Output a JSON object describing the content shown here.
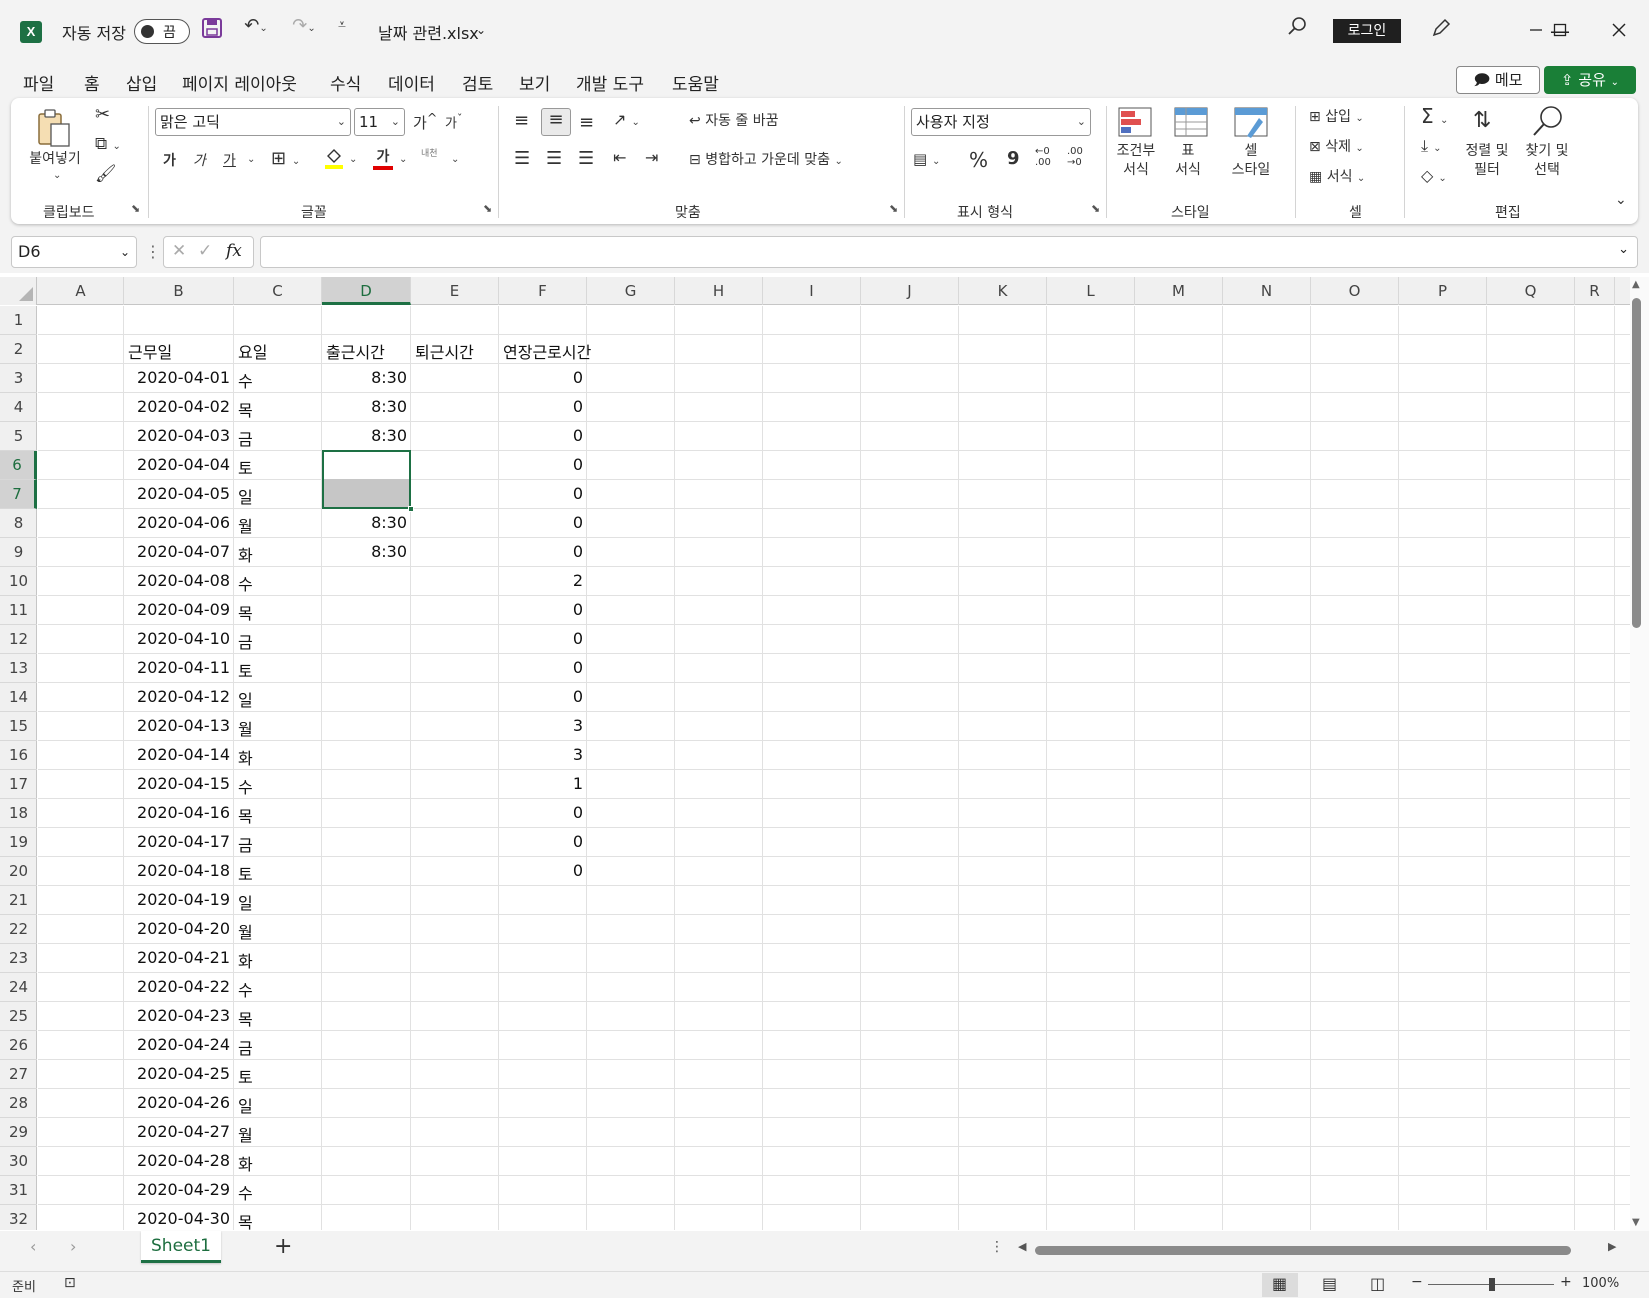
{
  "titlebar": {
    "app_icon": "excel-icon",
    "autosave_label": "자동 저장",
    "autosave_state": "끔",
    "filename": "날짜 관련.xlsx",
    "login_label": "로그인"
  },
  "menu": {
    "tabs": [
      "파일",
      "홈",
      "삽입",
      "페이지 레이아웃",
      "수식",
      "데이터",
      "검토",
      "보기",
      "개발 도구",
      "도움말"
    ],
    "active_tab": "홈",
    "memo_label": "메모",
    "share_label": "공유"
  },
  "ribbon": {
    "clipboard": {
      "paste_label": "붙여넣기",
      "group_label": "클립보드"
    },
    "font": {
      "font_name": "맑은 고딕",
      "font_size": "11",
      "bold": "가",
      "italic": "가",
      "underline": "가",
      "font_color_glyph": "가",
      "phonetic": "내천",
      "grow_font": "가",
      "shrink_font": "가",
      "group_label": "글꼴"
    },
    "alignment": {
      "wrap_text": "자동 줄 바꿈",
      "merge_center": "병합하고 가운데 맞춤",
      "group_label": "맞춤"
    },
    "number": {
      "format": "사용자 지정",
      "percent": "%",
      "comma": "9",
      "inc_decimal": "←0\n.00",
      "dec_decimal": ".00\n→0",
      "group_label": "표시 형식"
    },
    "styles": {
      "conditional": "조건부\n서식",
      "table": "표\n서식",
      "cell_styles": "셀\n스타일",
      "group_label": "스타일"
    },
    "cells": {
      "insert": "삽입",
      "delete": "삭제",
      "format": "서식",
      "group_label": "셀"
    },
    "editing": {
      "sort_filter": "정렬 및\n필터",
      "find_select": "찾기 및\n선택",
      "group_label": "편집"
    }
  },
  "formula_bar": {
    "name_box": "D6",
    "fx": "fx",
    "formula": ""
  },
  "sheet": {
    "columns": [
      "A",
      "B",
      "C",
      "D",
      "E",
      "F",
      "G",
      "H",
      "I",
      "J",
      "K",
      "L",
      "M",
      "N",
      "O",
      "P",
      "Q",
      "R"
    ],
    "selected_column": "D",
    "selected_rows": [
      6,
      7
    ],
    "rows": [
      {
        "n": 1,
        "B": "",
        "C": "",
        "D": "",
        "E": "",
        "F": ""
      },
      {
        "n": 2,
        "B": "근무일",
        "C": "요일",
        "D": "출근시간",
        "E": "퇴근시간",
        "F": "연장근로시간"
      },
      {
        "n": 3,
        "B": "2020-04-01",
        "C": "수",
        "D": "8:30",
        "E": "",
        "F": "0"
      },
      {
        "n": 4,
        "B": "2020-04-02",
        "C": "목",
        "D": "8:30",
        "E": "",
        "F": "0"
      },
      {
        "n": 5,
        "B": "2020-04-03",
        "C": "금",
        "D": "8:30",
        "E": "",
        "F": "0"
      },
      {
        "n": 6,
        "B": "2020-04-04",
        "C": "토",
        "D": "",
        "E": "",
        "F": "0"
      },
      {
        "n": 7,
        "B": "2020-04-05",
        "C": "일",
        "D": "",
        "E": "",
        "F": "0"
      },
      {
        "n": 8,
        "B": "2020-04-06",
        "C": "월",
        "D": "8:30",
        "E": "",
        "F": "0"
      },
      {
        "n": 9,
        "B": "2020-04-07",
        "C": "화",
        "D": "8:30",
        "E": "",
        "F": "0"
      },
      {
        "n": 10,
        "B": "2020-04-08",
        "C": "수",
        "D": "",
        "E": "",
        "F": "2"
      },
      {
        "n": 11,
        "B": "2020-04-09",
        "C": "목",
        "D": "",
        "E": "",
        "F": "0"
      },
      {
        "n": 12,
        "B": "2020-04-10",
        "C": "금",
        "D": "",
        "E": "",
        "F": "0"
      },
      {
        "n": 13,
        "B": "2020-04-11",
        "C": "토",
        "D": "",
        "E": "",
        "F": "0"
      },
      {
        "n": 14,
        "B": "2020-04-12",
        "C": "일",
        "D": "",
        "E": "",
        "F": "0"
      },
      {
        "n": 15,
        "B": "2020-04-13",
        "C": "월",
        "D": "",
        "E": "",
        "F": "3"
      },
      {
        "n": 16,
        "B": "2020-04-14",
        "C": "화",
        "D": "",
        "E": "",
        "F": "3"
      },
      {
        "n": 17,
        "B": "2020-04-15",
        "C": "수",
        "D": "",
        "E": "",
        "F": "1"
      },
      {
        "n": 18,
        "B": "2020-04-16",
        "C": "목",
        "D": "",
        "E": "",
        "F": "0"
      },
      {
        "n": 19,
        "B": "2020-04-17",
        "C": "금",
        "D": "",
        "E": "",
        "F": "0"
      },
      {
        "n": 20,
        "B": "2020-04-18",
        "C": "토",
        "D": "",
        "E": "",
        "F": "0"
      },
      {
        "n": 21,
        "B": "2020-04-19",
        "C": "일",
        "D": "",
        "E": "",
        "F": ""
      },
      {
        "n": 22,
        "B": "2020-04-20",
        "C": "월",
        "D": "",
        "E": "",
        "F": ""
      },
      {
        "n": 23,
        "B": "2020-04-21",
        "C": "화",
        "D": "",
        "E": "",
        "F": ""
      },
      {
        "n": 24,
        "B": "2020-04-22",
        "C": "수",
        "D": "",
        "E": "",
        "F": ""
      },
      {
        "n": 25,
        "B": "2020-04-23",
        "C": "목",
        "D": "",
        "E": "",
        "F": ""
      },
      {
        "n": 26,
        "B": "2020-04-24",
        "C": "금",
        "D": "",
        "E": "",
        "F": ""
      },
      {
        "n": 27,
        "B": "2020-04-25",
        "C": "토",
        "D": "",
        "E": "",
        "F": ""
      },
      {
        "n": 28,
        "B": "2020-04-26",
        "C": "일",
        "D": "",
        "E": "",
        "F": ""
      },
      {
        "n": 29,
        "B": "2020-04-27",
        "C": "월",
        "D": "",
        "E": "",
        "F": ""
      },
      {
        "n": 30,
        "B": "2020-04-28",
        "C": "화",
        "D": "",
        "E": "",
        "F": ""
      },
      {
        "n": 31,
        "B": "2020-04-29",
        "C": "수",
        "D": "",
        "E": "",
        "F": ""
      },
      {
        "n": 32,
        "B": "2020-04-30",
        "C": "목",
        "D": "",
        "E": "",
        "F": ""
      }
    ]
  },
  "sheet_tabs": {
    "tabs": [
      "Sheet1"
    ],
    "add_label": "+"
  },
  "status": {
    "ready": "준비",
    "zoom": "100%"
  },
  "colors": {
    "accent": "#1d7044",
    "share_bg": "#1a7f37",
    "header_bg": "#f0f0f0",
    "selection_fill": "#c6c6c6"
  }
}
